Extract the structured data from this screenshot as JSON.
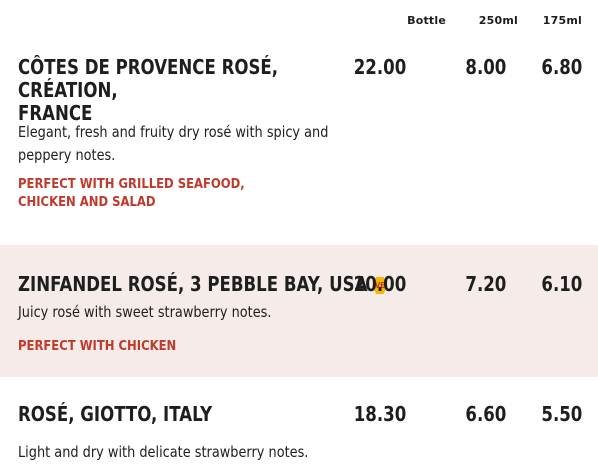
{
  "columns": {
    "bottle": "Bottle",
    "ml250": "250ml",
    "ml175": "175ml"
  },
  "wines": [
    {
      "name_line1": "Côtes de Provence Rosé, Création,",
      "name_line2": "France",
      "bottle": "22.00",
      "ml250": "8.00",
      "ml175": "6.80",
      "desc_line1": "Elegant, fresh and fruity dry rosé with spicy and",
      "desc_line2": "peppery notes.",
      "pair_line1": "Perfect with grilled seafood,",
      "pair_line2": "chicken and salad"
    },
    {
      "name": "Zinfandel Rosé, 3 Pebble Bay, USA",
      "badge": "VE",
      "bottle": "20.00",
      "ml250": "7.20",
      "ml175": "6.10",
      "desc": "Juicy rosé with sweet strawberry notes.",
      "pair": "Perfect with chicken"
    },
    {
      "name": "Rosé, Giotto, Italy",
      "bottle": "18.30",
      "ml250": "6.60",
      "ml175": "5.50",
      "desc": "Light and dry with delicate strawberry notes."
    }
  ],
  "colors": {
    "accent": "#c0392b",
    "band": "#f5ebe8",
    "badge": "#f5b800"
  }
}
